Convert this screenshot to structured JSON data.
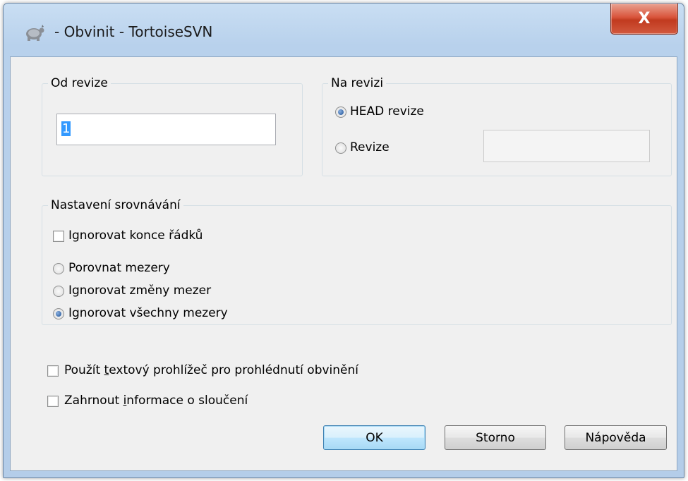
{
  "window": {
    "title": "- Obvinit - TortoiseSVN",
    "close_label": "X"
  },
  "from_revision": {
    "legend": "Od revize",
    "value": "1"
  },
  "to_revision": {
    "legend": "Na revizi",
    "options": [
      {
        "label": "HEAD revize",
        "checked": true
      },
      {
        "label": "Revize",
        "checked": false
      }
    ],
    "revision_value": ""
  },
  "diff_options": {
    "legend": "Nastavení srovnávání",
    "ignore_eol": {
      "label": "Ignorovat konce řádků",
      "checked": false
    },
    "whitespace": [
      {
        "label": "Porovnat mezery",
        "checked": false
      },
      {
        "label": "Ignorovat změny mezer",
        "checked": false
      },
      {
        "label": "Ignorovat všechny mezery",
        "checked": true
      }
    ]
  },
  "text_viewer": {
    "label_pre": "Použít ",
    "label_accel": "t",
    "label_post": "extový prohlížeč pro prohlédnutí obvinění",
    "checked": false
  },
  "merge_info": {
    "label_pre": "Zahrnout ",
    "label_accel": "i",
    "label_post": "nformace o sloučení",
    "checked": false
  },
  "buttons": {
    "ok": "OK",
    "cancel": "Storno",
    "help": "Nápověda"
  }
}
